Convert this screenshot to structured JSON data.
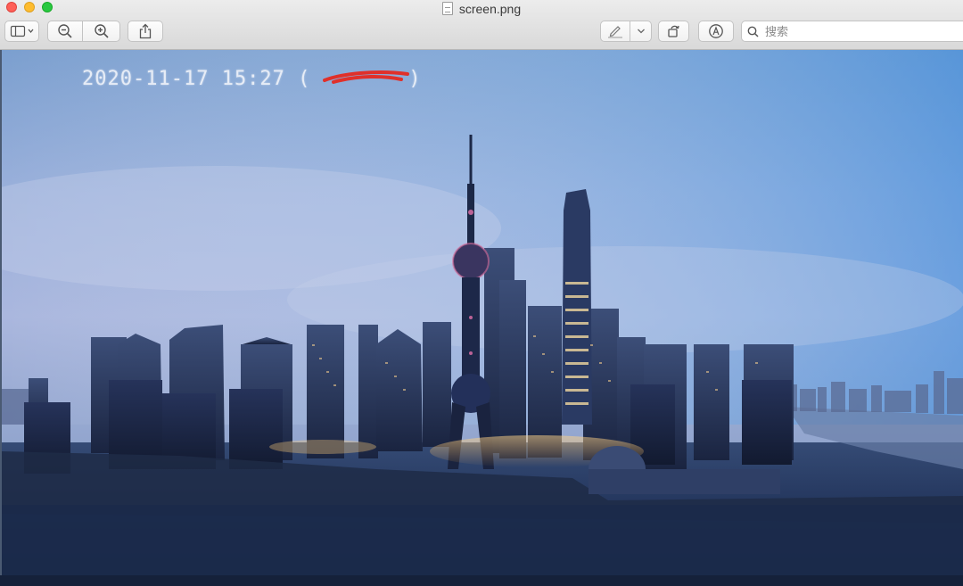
{
  "window": {
    "title": "screen.png",
    "file_icon": "png-file-icon"
  },
  "toolbar": {
    "sidebar_icon": "sidebar-toggle-icon",
    "zoom_out_icon": "zoom-out-icon",
    "zoom_in_icon": "zoom-in-icon",
    "share_icon": "share-icon",
    "markup_icon": "pen-icon",
    "markup_menu_icon": "chevron-down-icon",
    "rotate_icon": "rotate-icon",
    "annotate_icon": "markup-circle-icon",
    "search": {
      "placeholder": "搜索",
      "value": ""
    }
  },
  "image": {
    "subject": "Shanghai skyline at dusk",
    "timestamp": "2020-11-17 15:27 (",
    "timestamp_end": ")",
    "redaction_color": "#e0302a"
  },
  "colors": {
    "sky_top": "#4a8fd6",
    "sky_horizon": "#aab7de",
    "water": "#1d2f55"
  }
}
